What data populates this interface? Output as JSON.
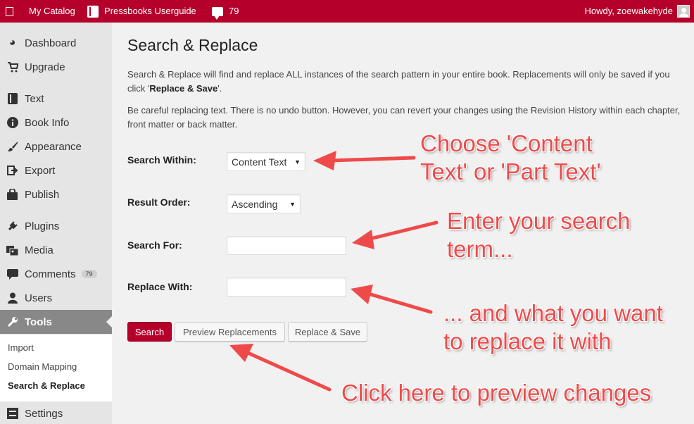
{
  "adminbar": {
    "catalog": "My Catalog",
    "book_title": "Pressbooks Userguide",
    "comment_count": "79",
    "howdy": "Howdy, zoewakehyde"
  },
  "sidebar": {
    "items": [
      {
        "label": "Dashboard",
        "icon": "dashboard-icon"
      },
      {
        "label": "Upgrade",
        "icon": "cart-icon"
      },
      {
        "label": "Text",
        "icon": "book-icon"
      },
      {
        "label": "Book Info",
        "icon": "info-icon"
      },
      {
        "label": "Appearance",
        "icon": "brush-icon"
      },
      {
        "label": "Export",
        "icon": "export-icon"
      },
      {
        "label": "Publish",
        "icon": "bag-icon"
      },
      {
        "label": "Plugins",
        "icon": "plug-icon"
      },
      {
        "label": "Media",
        "icon": "media-icon"
      },
      {
        "label": "Comments",
        "icon": "comment-icon",
        "badge": "79"
      },
      {
        "label": "Users",
        "icon": "user-icon"
      },
      {
        "label": "Tools",
        "icon": "wrench-icon"
      },
      {
        "label": "Settings",
        "icon": "settings-icon"
      }
    ],
    "submenu": [
      "Import",
      "Domain Mapping",
      "Search & Replace"
    ]
  },
  "main": {
    "title": "Search & Replace",
    "desc1_a": "Search & Replace will find and replace ALL instances of the search pattern in your entire book. Replacements will only be saved if you click '",
    "desc1_b": "Replace & Save",
    "desc1_c": "'.",
    "desc2": "Be careful replacing text. There is no undo button. However, you can revert your changes using the Revision History within each chapter, front matter or back matter.",
    "search_within_label": "Search Within:",
    "search_within_value": "Content Text",
    "result_order_label": "Result Order:",
    "result_order_value": "Ascending",
    "search_for_label": "Search For:",
    "search_for_value": "",
    "replace_with_label": "Replace With:",
    "replace_with_value": "",
    "btn_search": "Search",
    "btn_preview": "Preview Replacements",
    "btn_replace_save": "Replace & Save"
  },
  "annotations": {
    "a1_line1": "Choose 'Content",
    "a1_line2": "Text' or 'Part Text'",
    "a2_line1": "Enter your search",
    "a2_line2": "term...",
    "a3_line1": "... and what you want",
    "a3_line2": "to replace it with",
    "a4": "Click here to preview changes"
  },
  "colors": {
    "brand": "#b5002c",
    "annotation": "#ef4a4a"
  }
}
